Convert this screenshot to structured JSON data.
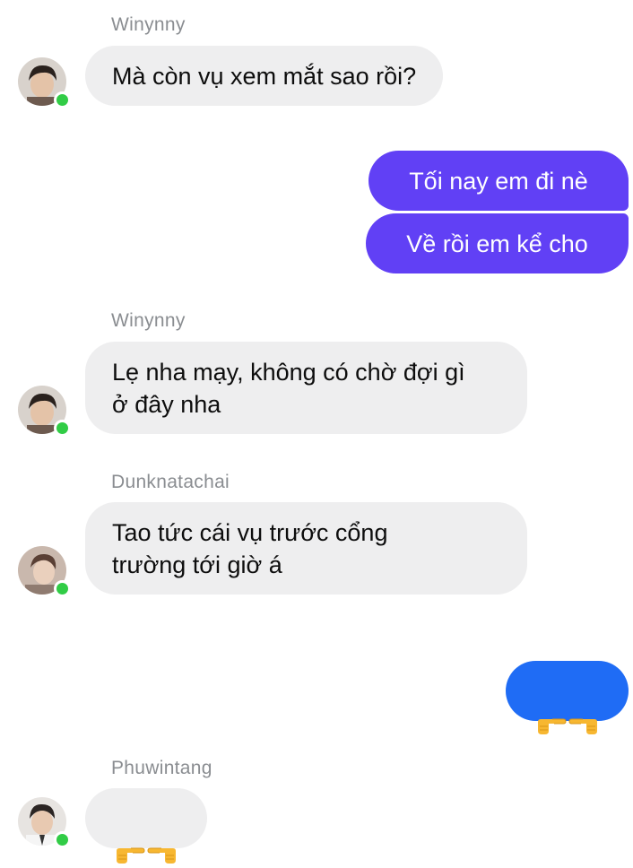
{
  "colors": {
    "outgoing_bubble": "#6140f5",
    "outgoing_emoji_bubble": "#1f6cf5",
    "incoming_bubble": "#eeeeef",
    "online_indicator": "#31cc46",
    "sender_name": "#8a8d91"
  },
  "messages": [
    {
      "sender": "Winynny",
      "text": "Mà còn vụ xem mắt sao rồi?"
    },
    {
      "sender": "me",
      "text": "Tối nay em đi nè"
    },
    {
      "sender": "me",
      "text": "Về rồi em kể cho"
    },
    {
      "sender": "Winynny",
      "text": "Lẹ nha mạy, không có chờ đợi gì\nở đây nha"
    },
    {
      "sender": "Dunknatachai",
      "text": "Tao tức cái vụ trước cổng\ntrường tới giờ á"
    },
    {
      "sender": "me",
      "emoji": "👉👈"
    },
    {
      "sender": "Phuwintang",
      "emoji": "👉👈"
    }
  ]
}
